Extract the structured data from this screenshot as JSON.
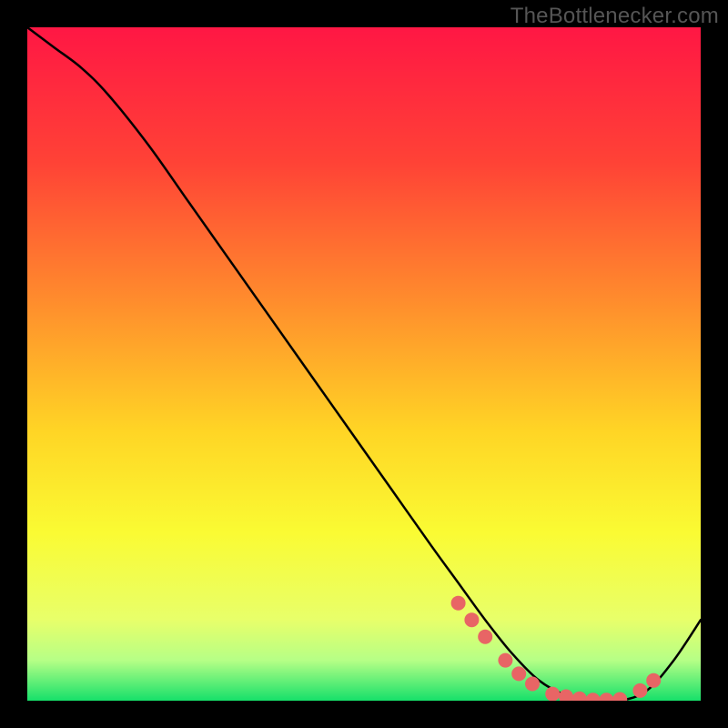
{
  "watermark": "TheBottlenecker.com",
  "chart_data": {
    "type": "line",
    "title": "",
    "xlabel": "",
    "ylabel": "",
    "xlim": [
      0,
      100
    ],
    "ylim": [
      0,
      100
    ],
    "background_gradient": {
      "stops": [
        {
          "offset": 0,
          "color": "#ff1744"
        },
        {
          "offset": 20,
          "color": "#ff4236"
        },
        {
          "offset": 40,
          "color": "#ff8a2d"
        },
        {
          "offset": 60,
          "color": "#ffd525"
        },
        {
          "offset": 75,
          "color": "#fafb33"
        },
        {
          "offset": 88,
          "color": "#e8ff6a"
        },
        {
          "offset": 94,
          "color": "#b6ff86"
        },
        {
          "offset": 100,
          "color": "#16e06a"
        }
      ]
    },
    "curve": {
      "x": [
        0,
        4,
        8,
        12,
        18,
        24,
        30,
        36,
        42,
        48,
        54,
        60,
        64,
        68,
        72,
        76,
        80,
        84,
        88,
        92,
        96,
        100
      ],
      "y": [
        100,
        97,
        94,
        90,
        82.5,
        74,
        65.5,
        57,
        48.5,
        40,
        31.5,
        23,
        17.5,
        12,
        7,
        3,
        0.8,
        0,
        0,
        1.5,
        6,
        12
      ]
    },
    "markers": {
      "x": [
        64,
        66,
        68,
        71,
        73,
        75,
        78,
        80,
        82,
        84,
        86,
        88,
        91,
        93
      ],
      "y": [
        14.5,
        12,
        9.5,
        6,
        4,
        2.5,
        1,
        0.6,
        0.3,
        0.1,
        0.1,
        0.2,
        1.5,
        3
      ],
      "color": "#e86565",
      "radius": 8
    }
  }
}
